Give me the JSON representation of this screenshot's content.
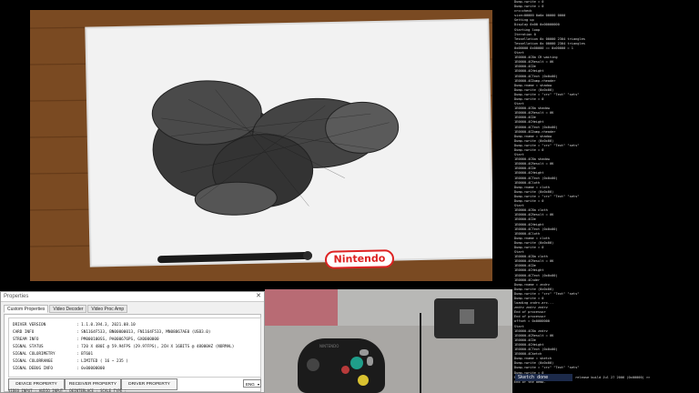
{
  "game": {
    "logo_text": "Nintendo"
  },
  "console": {
    "lines": [
      "Dump->write = 0",
      "Dump->write = 0",
      "crc=check",
      "size=00000 0a0a 00000 0000",
      "Setting up",
      "Display 0x00 0x00000000",
      "Starting loop",
      "Iteration 0",
      "Tessellation 0x 00000 2304 triangles",
      "Tessellation 0x 00000 2304 triangles",
      "0x00000 0x00000 == 0x00000 = 1",
      "Start",
      "1E0000.4CBa CR waiting",
      "1E0000.4CResult = 0K",
      "1E0000.4CDe",
      "1E0000.4CHeight",
      "1E0000.4CText (0x0x00)",
      "1E0000.4CDump->header",
      "Dump->name = shadow",
      "Dump->write (0x0x00)",
      "Dump->write = \"crc\" \"Text\" \"sets\"",
      "Dump->write = 0",
      "Start",
      "1E0000.4CBa shadow",
      "1E0000.4CResult = 0K",
      "1E0000.4CDe",
      "1E0000.4CHeight",
      "1E0000.4CText (0x0x00)",
      "1E0000.4CDump->header",
      "Dump->name = shadow",
      "Dump->write (0x0x00)",
      "Dump->write = \"crc\" \"Text\" \"sets\"",
      "Dump->write = 0",
      "Start",
      "1E0000.4CBa shadow",
      "1E0000.4CResult = 0K",
      "1E0000.4CDe",
      "1E0000.4CHeight",
      "1E0000.4CText (0x0x00)",
      "1E0000.4Cloth",
      "Dump->name = cloth",
      "Dump->write (0x0x00)",
      "Dump->write = \"crc\" \"Text\" \"sets\"",
      "Dump->write = 0",
      "Start",
      "1E0000.4CBa cloth",
      "1E0000.4CResult = 0K",
      "1E0000.4CDe",
      "1E0000.4CHeight",
      "1E0000.4CText (0x0x00)",
      "1E0000.4Cloth",
      "Dump->name = cloth",
      "Dump->write (0x0x00)",
      "Dump->write = 0",
      "Start",
      "1E0000.4CBa cloth",
      "1E0000.4CResult = 0K",
      "1E0000.4CDe",
      "1E0000.4CHeight",
      "1E0000.4CText (0x0x00)",
      "1E0000.4Cnder",
      "Dump->name = zndrv",
      "Dump->write (0x0x00)",
      "Dump->write = \"crc\" \"Text\" \"sets\"",
      "Dump->write = 0",
      "loading zndrv.arc...",
      "zndrv zndrv zndrv",
      "End of processor",
      "End of processor",
      "offset = 0x0000000",
      "Start",
      "1E0000.4CBa zndrv",
      "1E0000.4CResult = 0K",
      "1E0000.4CDe",
      "1E0000.4CHeight",
      "1E0000.4CText (0x0x00)",
      "1E0000.4Cketch",
      "Dump->name = sketch",
      "Dump->write (0x0x00)",
      "Dump->write = \"crc\" \"Text\" \"sets\"",
      "Dump->write = 0",
      "PC_000 000 = 0                 release build Jul 27 2006 (0x00000) >>",
      "",
      "",
      "End of the demo."
    ],
    "status": "Sketch done"
  },
  "properties": {
    "title": "Properties",
    "tabs": [
      "Custom Properties",
      "Video Decoder",
      "Video Proc Amp"
    ],
    "info": [
      {
        "key": "DRIVER VERSION",
        "value": ": 1.1.0.194.3, 2021.08.10"
      },
      {
        "key": "CARD INFO",
        "value": ": SN1164F533, BN00000013, FN1164F533, MN08867AE0 (USB3.0)"
      },
      {
        "key": "STREAM INFO",
        "value": ": PM000100SS, PA000676PS, GX0000000"
      },
      {
        "key": "SIGNAL STATUS",
        "value": ": 720 X 480I @ 59.94FPS (29.97FPS), 2CH X 16BITS @ 48000HZ (NORMAL)"
      },
      {
        "key": "SIGNAL COLORIMETRY",
        "value": ": BT601"
      },
      {
        "key": "SIGNAL COLORRANGE",
        "value": ": LIMITED ( 16 ~ 235 )"
      },
      {
        "key": "SIGNAL DEBUG INFO",
        "value": ": 0x00000000"
      }
    ],
    "buttons": [
      "DEVICE PROPERTY",
      "RECEIVER PROPERTY",
      "DRIVER PROPERTY"
    ],
    "language": "ENG",
    "footer": "VIDEO INPUT :        AUDIO INPUT :        DEINTERLACE :        SCALE TYPE :"
  },
  "webcam": {
    "controller_brand": "NINTENDO"
  }
}
